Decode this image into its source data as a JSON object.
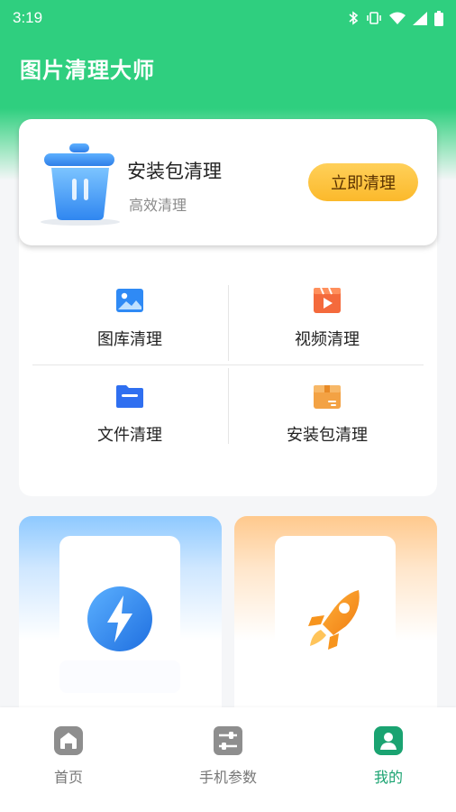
{
  "status_bar": {
    "time": "3:19"
  },
  "app": {
    "title": "图片清理大师"
  },
  "hero": {
    "title": "安装包清理",
    "subtitle": "高效清理",
    "button_label": "立即清理"
  },
  "grid": {
    "items": [
      {
        "label": "图库清理",
        "icon": "gallery-icon",
        "color": "#2f8af5"
      },
      {
        "label": "视频清理",
        "icon": "video-icon",
        "color": "#f46a3c"
      },
      {
        "label": "文件清理",
        "icon": "folder-icon",
        "color": "#2f6ff0"
      },
      {
        "label": "安装包清理",
        "icon": "package-icon",
        "color": "#f3a244"
      }
    ]
  },
  "promos": [
    {
      "icon": "lightning-icon",
      "color": "#2f8af5"
    },
    {
      "icon": "rocket-icon",
      "color": "#f79a1f"
    }
  ],
  "bottom_nav": {
    "items": [
      {
        "label": "首页",
        "icon": "home-icon"
      },
      {
        "label": "手机参数",
        "icon": "sliders-icon"
      },
      {
        "label": "我的",
        "icon": "profile-icon"
      }
    ],
    "active_index": 2,
    "active_color": "#1aa371"
  },
  "colors": {
    "brand_green": "#2fcf7f",
    "button_yellow": "#fbb92b"
  }
}
